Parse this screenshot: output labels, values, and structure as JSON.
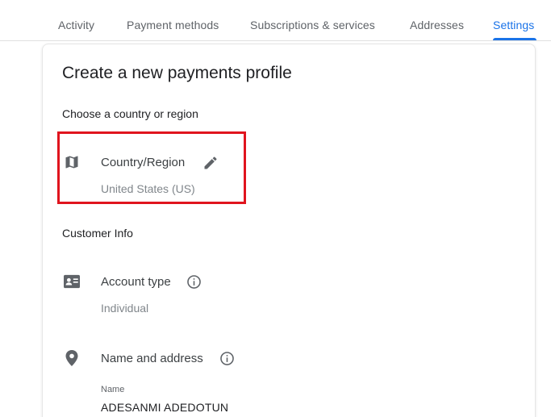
{
  "tabs": [
    {
      "label": "Activity"
    },
    {
      "label": "Payment methods"
    },
    {
      "label": "Subscriptions & services"
    },
    {
      "label": "Addresses"
    },
    {
      "label": "Settings",
      "active": true
    }
  ],
  "card": {
    "title": "Create a new payments profile",
    "country_section": {
      "heading": "Choose a country or region",
      "field_label": "Country/Region",
      "field_value": "United States (US)",
      "icon": "map-icon",
      "edit_icon": "pencil-icon"
    },
    "customer_section": {
      "heading": "Customer Info",
      "account_type": {
        "label": "Account type",
        "value": "Individual",
        "icon": "id-card-icon",
        "info_icon": "info-icon"
      },
      "name_address": {
        "label": "Name and address",
        "icon": "location-pin-icon",
        "info_icon": "info-icon",
        "name_caption": "Name",
        "name_value": "ADESANMI ADEDOTUN"
      }
    }
  },
  "colors": {
    "accent": "#1a73e8",
    "highlight": "#e0141e",
    "muted_text": "#80868b"
  }
}
